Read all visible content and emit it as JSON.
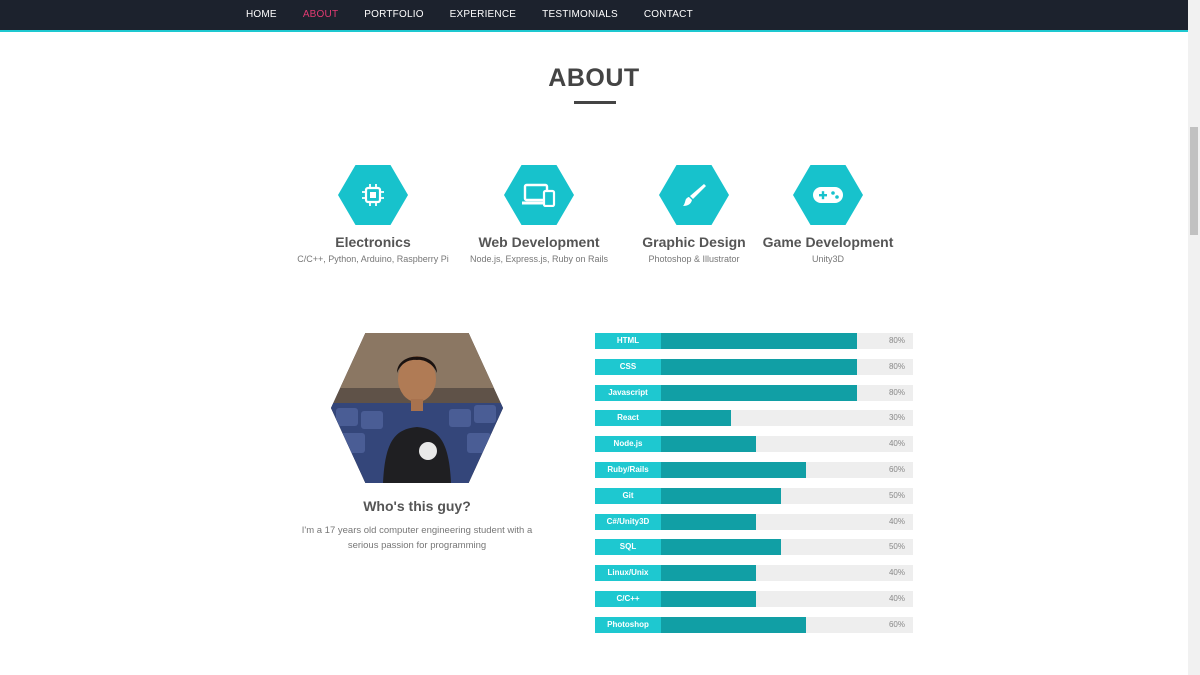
{
  "nav": {
    "items": [
      {
        "label": "HOME",
        "active": false
      },
      {
        "label": "ABOUT",
        "active": true
      },
      {
        "label": "PORTFOLIO",
        "active": false
      },
      {
        "label": "EXPERIENCE",
        "active": false
      },
      {
        "label": "TESTIMONIALS",
        "active": false
      },
      {
        "label": "CONTACT",
        "active": false
      }
    ]
  },
  "section": {
    "title": "ABOUT"
  },
  "services": [
    {
      "icon": "chip-icon",
      "title": "Electronics",
      "desc": "C/C++, Python, Arduino, Raspberry Pi"
    },
    {
      "icon": "devices-icon",
      "title": "Web Development",
      "desc": "Node.js, Express.js, Ruby on Rails"
    },
    {
      "icon": "paintbrush-icon",
      "title": "Graphic Design",
      "desc": "Photoshop & Illustrator"
    },
    {
      "icon": "gamepad-icon",
      "title": "Game Development",
      "desc": "Unity3D"
    }
  ],
  "profile": {
    "title": "Who's this guy?",
    "text": "I'm a 17 years old computer engineering student with a serious passion for programming"
  },
  "skills": [
    {
      "name": "HTML",
      "percent": 80,
      "label": "80%"
    },
    {
      "name": "CSS",
      "percent": 80,
      "label": "80%"
    },
    {
      "name": "Javascript",
      "percent": 80,
      "label": "80%"
    },
    {
      "name": "React",
      "percent": 30,
      "label": "30%"
    },
    {
      "name": "Node.js",
      "percent": 40,
      "label": "40%"
    },
    {
      "name": "Ruby/Rails",
      "percent": 60,
      "label": "60%"
    },
    {
      "name": "Git",
      "percent": 50,
      "label": "50%"
    },
    {
      "name": "C#/Unity3D",
      "percent": 40,
      "label": "40%"
    },
    {
      "name": "SQL",
      "percent": 50,
      "label": "50%"
    },
    {
      "name": "Linux/Unix",
      "percent": 40,
      "label": "40%"
    },
    {
      "name": "C/C++",
      "percent": 40,
      "label": "40%"
    },
    {
      "name": "Photoshop",
      "percent": 60,
      "label": "60%"
    }
  ],
  "colors": {
    "accent": "#1ec8d0",
    "accent_dark": "#119fa5",
    "nav_bg": "#1c222d",
    "nav_active": "#e23a72"
  }
}
